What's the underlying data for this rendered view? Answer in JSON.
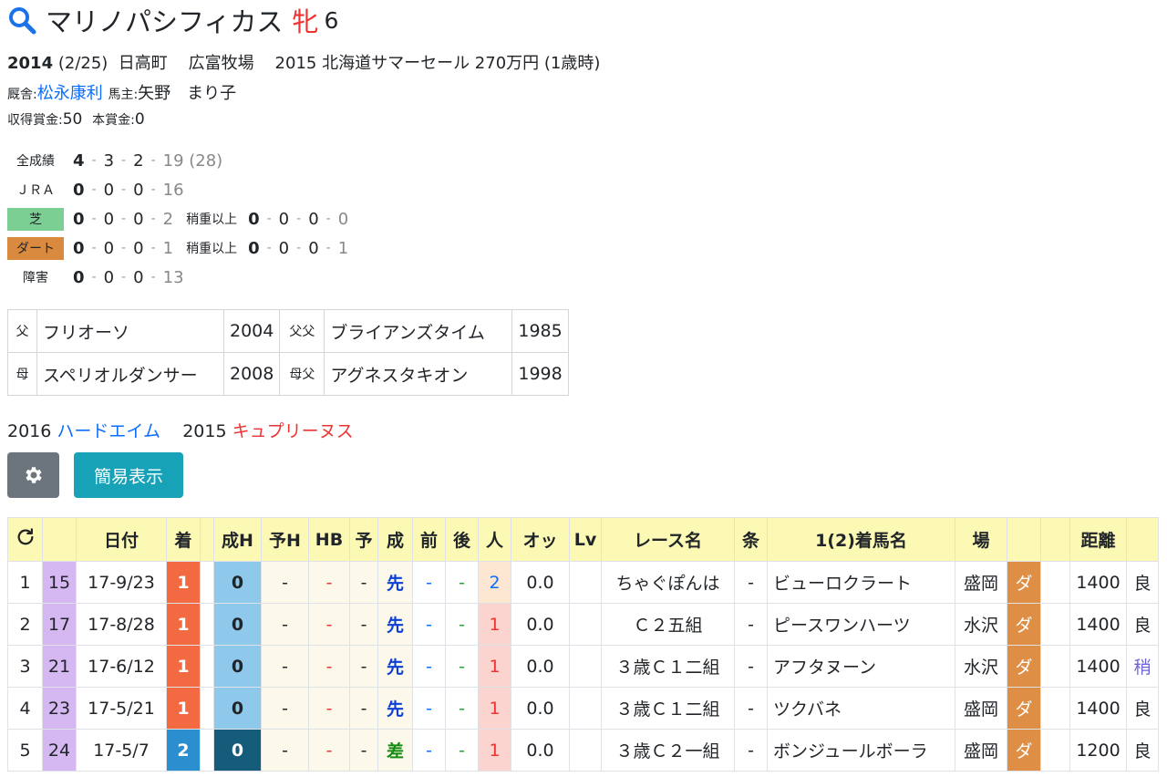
{
  "header": {
    "horse_name": "マリノパシフィカス",
    "sex": "牝",
    "age": "6"
  },
  "profile": {
    "birth_year": "2014",
    "birth_date": "(2/25)",
    "region": "日高町",
    "farm": "広富牧場",
    "sale": "2015 北海道サマーセール 270万円 (1歳時)",
    "trainer_label": "厩舎:",
    "trainer": "松永康利",
    "owner_label": "馬主:",
    "owner": "矢野　まり子",
    "earnings_label": "収得賞金:",
    "earnings": "50",
    "prize_label": "本賞金:",
    "prize": "0"
  },
  "records": [
    {
      "label": "全成績",
      "type": "plain",
      "w": "4",
      "s": "3",
      "t": "2",
      "o": "19 (28)"
    },
    {
      "label": "ＪＲＡ",
      "type": "plain",
      "w": "0",
      "s": "0",
      "t": "0",
      "o": "16"
    },
    {
      "label": "芝",
      "type": "turf",
      "w": "0",
      "s": "0",
      "t": "0",
      "o": "2",
      "cond_label": "稍重以上",
      "cw": "0",
      "cs": "0",
      "ct": "0",
      "co": "0"
    },
    {
      "label": "ダート",
      "type": "dirt",
      "w": "0",
      "s": "0",
      "t": "0",
      "o": "1",
      "cond_label": "稍重以上",
      "cw": "0",
      "cs": "0",
      "ct": "0",
      "co": "1"
    },
    {
      "label": "障害",
      "type": "plain",
      "w": "0",
      "s": "0",
      "t": "0",
      "o": "13"
    }
  ],
  "pedigree": {
    "sire_label": "父",
    "sire": "フリオーソ",
    "sire_year": "2004",
    "sire_sire_label": "父父",
    "sire_sire": "ブライアンズタイム",
    "sire_sire_year": "1985",
    "dam_label": "母",
    "dam": "スペリオルダンサー",
    "dam_year": "2008",
    "dam_sire_label": "母父",
    "dam_sire": "アグネスタキオン",
    "dam_sire_year": "1998"
  },
  "siblings": [
    {
      "year": "2016",
      "name": "ハードエイム",
      "color": "#0d6efd"
    },
    {
      "year": "2015",
      "name": "キュプリーヌス",
      "color": "#e33333"
    }
  ],
  "buttons": {
    "simple": "簡易表示"
  },
  "table": {
    "headers": [
      "",
      "",
      "日付",
      "着",
      "",
      "成H",
      "予H",
      "HB",
      "予",
      "成",
      "前",
      "後",
      "人",
      "オッ",
      "Lv",
      "レース名",
      "条",
      "1(2)着馬名",
      "場",
      "",
      "",
      "距離",
      ""
    ],
    "rows": [
      {
        "idx": "1",
        "age": "15",
        "date": "17-9/23",
        "rank": "1",
        "sei": "0",
        "yoh": "-",
        "hb": "-",
        "yo": "-",
        "kyaku": "先",
        "mae": "-",
        "ato": "-",
        "pop": "2",
        "odds": "0.0",
        "lv": "",
        "race": "ちゃぐぽんは",
        "jo": "-",
        "winner": "ビューロクラート",
        "venue": "盛岡",
        "track": "ダ",
        "dist": "1400",
        "cond": "良"
      },
      {
        "idx": "2",
        "age": "17",
        "date": "17-8/28",
        "rank": "1",
        "sei": "0",
        "yoh": "-",
        "hb": "-",
        "yo": "-",
        "kyaku": "先",
        "mae": "-",
        "ato": "-",
        "pop": "1",
        "odds": "0.0",
        "lv": "",
        "race": "Ｃ２五組",
        "jo": "-",
        "winner": "ピースワンハーツ",
        "venue": "水沢",
        "track": "ダ",
        "dist": "1400",
        "cond": "良"
      },
      {
        "idx": "3",
        "age": "21",
        "date": "17-6/12",
        "rank": "1",
        "sei": "0",
        "yoh": "-",
        "hb": "-",
        "yo": "-",
        "kyaku": "先",
        "mae": "-",
        "ato": "-",
        "pop": "1",
        "odds": "0.0",
        "lv": "",
        "race": "３歳Ｃ１二組",
        "jo": "-",
        "winner": "アフタヌーン",
        "venue": "水沢",
        "track": "ダ",
        "dist": "1400",
        "cond": "稍"
      },
      {
        "idx": "4",
        "age": "23",
        "date": "17-5/21",
        "rank": "1",
        "sei": "0",
        "yoh": "-",
        "hb": "-",
        "yo": "-",
        "kyaku": "先",
        "mae": "-",
        "ato": "-",
        "pop": "1",
        "odds": "0.0",
        "lv": "",
        "race": "３歳Ｃ１二組",
        "jo": "-",
        "winner": "ツクバネ",
        "venue": "盛岡",
        "track": "ダ",
        "dist": "1400",
        "cond": "良"
      },
      {
        "idx": "5",
        "age": "24",
        "date": "17-5/7",
        "rank": "2",
        "sei": "0",
        "yoh": "-",
        "hb": "-",
        "yo": "-",
        "kyaku": "差",
        "mae": "-",
        "ato": "-",
        "pop": "1",
        "odds": "0.0",
        "lv": "",
        "race": "３歳Ｃ２一組",
        "jo": "-",
        "winner": "ボンジュールボーラ",
        "venue": "盛岡",
        "track": "ダ",
        "dist": "1200",
        "cond": "良"
      }
    ]
  }
}
